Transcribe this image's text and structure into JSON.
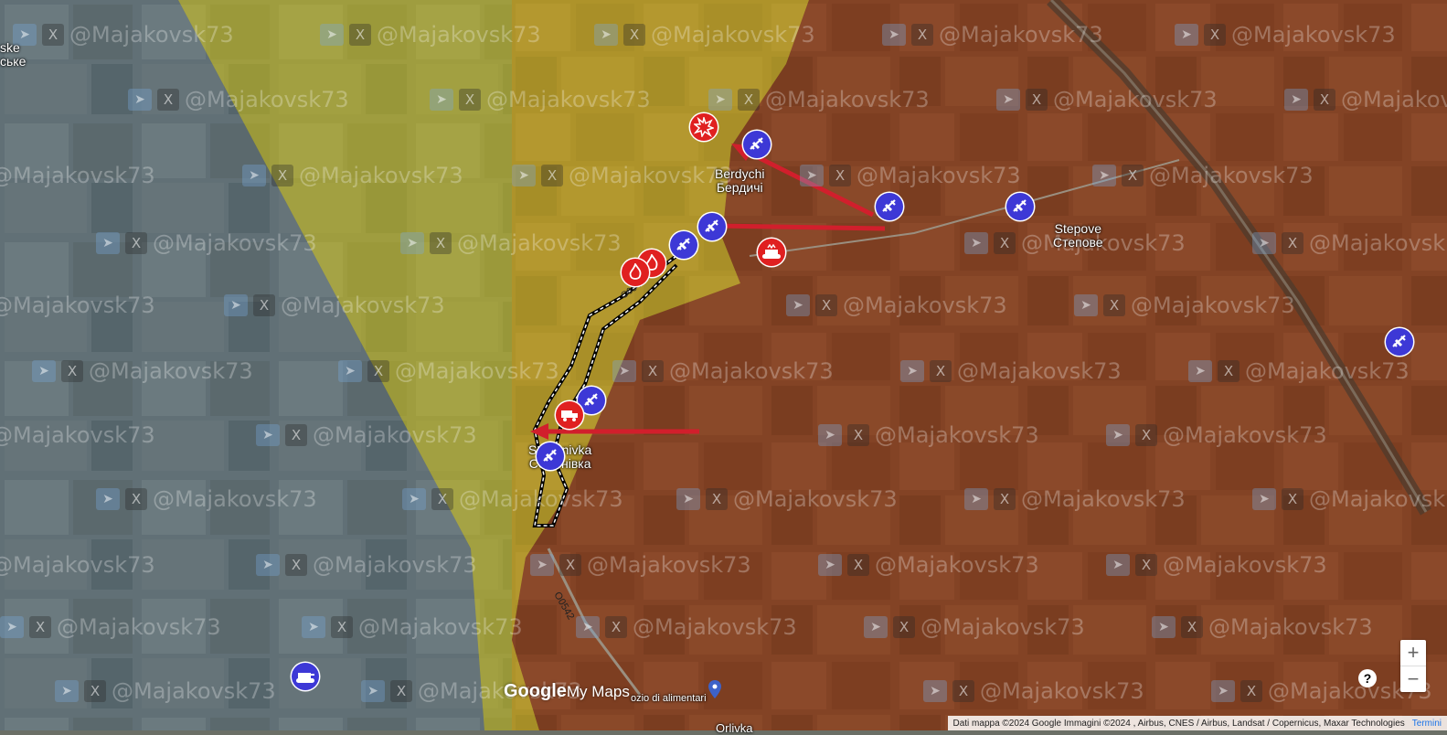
{
  "places": {
    "top_left_1": "ske",
    "top_left_2": "ське",
    "berdychi_lat": "Berdychi",
    "berdychi_cyr": "Бердичі",
    "stepove_lat": "Stepove",
    "stepove_cyr": "Степове",
    "semenivka_lat": "Semenivka",
    "semenivka_cyr": "Семенівка",
    "orlivka": "Orlivka",
    "store": "ozio di alimentari"
  },
  "roads": {
    "r1": "O0542",
    "r2": "O0542"
  },
  "watermark": {
    "text": "@Majakovsk73",
    "tg": "➤",
    "x": "X"
  },
  "branding": {
    "google": "Google",
    "mymaps": "My Maps"
  },
  "attribution": {
    "text": "Dati mappa ©2024 Google Immagini ©2024 , Airbus, CNES / Airbus, Landsat / Copernicus, Maxar Technologies",
    "terms": "Termini"
  },
  "controls": {
    "zoom_in": "+",
    "zoom_out": "−",
    "help": "?"
  },
  "colors": {
    "russian_controlled": "#8a3b1c",
    "contested": "#c9c332",
    "ukrainian_side": "#6fa8dc",
    "aviation_marker": "#3d38d6",
    "attack_marker": "#e02020",
    "attack_arrow": "#d11f2c"
  },
  "markers": [
    {
      "type": "aviation",
      "icon": "jet-icon"
    },
    {
      "type": "aviation",
      "icon": "jet-icon"
    },
    {
      "type": "aviation",
      "icon": "jet-icon"
    },
    {
      "type": "aviation",
      "icon": "jet-icon"
    },
    {
      "type": "aviation",
      "icon": "jet-icon"
    },
    {
      "type": "aviation",
      "icon": "jet-icon"
    },
    {
      "type": "aviation",
      "icon": "jet-icon"
    },
    {
      "type": "aviation",
      "icon": "jet-icon"
    },
    {
      "type": "aviation",
      "icon": "jet-icon"
    },
    {
      "type": "armor",
      "icon": "tank-icon"
    },
    {
      "type": "explosion",
      "icon": "explosion-icon"
    },
    {
      "type": "fire",
      "icon": "fire-icon"
    },
    {
      "type": "fire",
      "icon": "fire-icon"
    },
    {
      "type": "armor_destroyed",
      "icon": "tank-icon"
    },
    {
      "type": "vehicle",
      "icon": "truck-icon"
    }
  ]
}
